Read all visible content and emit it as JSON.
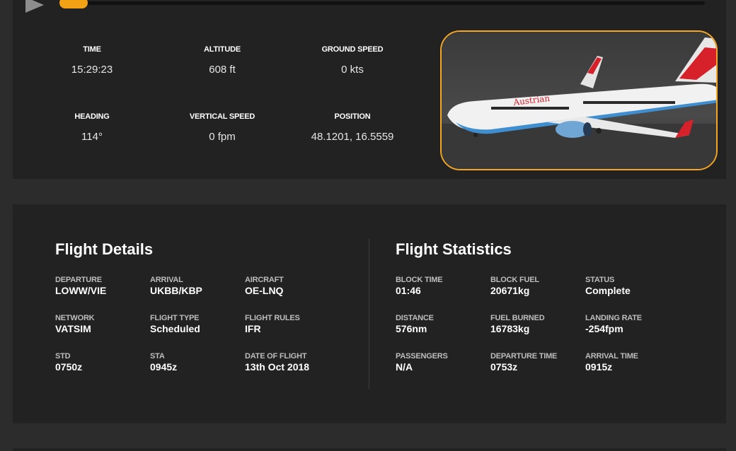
{
  "player": {
    "play_icon": "play-icon",
    "progress_fraction": 0.0,
    "accent": "#f3a215"
  },
  "live": [
    {
      "label": "TIME",
      "value": "15:29:23"
    },
    {
      "label": "ALTITUDE",
      "value": "608 ft"
    },
    {
      "label": "GROUND SPEED",
      "value": "0 kts"
    },
    {
      "label": "HEADING",
      "value": "114°"
    },
    {
      "label": "VERTICAL SPEED",
      "value": "0 fpm"
    },
    {
      "label": "POSITION",
      "value": "48.1201, 16.5559"
    }
  ],
  "photo": {
    "livery_text": "Austrian",
    "border_color": "#f5a623"
  },
  "flight_details": {
    "title": "Flight Details",
    "fields": [
      {
        "label": "DEPARTURE",
        "value": "LOWW/VIE"
      },
      {
        "label": "ARRIVAL",
        "value": "UKBB/KBP"
      },
      {
        "label": "AIRCRAFT",
        "value": "OE-LNQ"
      },
      {
        "label": "NETWORK",
        "value": "VATSIM"
      },
      {
        "label": "FLIGHT TYPE",
        "value": "Scheduled"
      },
      {
        "label": "FLIGHT RULES",
        "value": "IFR"
      },
      {
        "label": "STD",
        "value": "0750z"
      },
      {
        "label": "STA",
        "value": "0945z"
      },
      {
        "label": "DATE OF FLIGHT",
        "value": "13th Oct 2018"
      }
    ]
  },
  "flight_statistics": {
    "title": "Flight Statistics",
    "fields": [
      {
        "label": "BLOCK TIME",
        "value": "01:46"
      },
      {
        "label": "BLOCK FUEL",
        "value": "20671kg"
      },
      {
        "label": "STATUS",
        "value": "Complete"
      },
      {
        "label": "DISTANCE",
        "value": "576nm"
      },
      {
        "label": "FUEL BURNED",
        "value": "16783kg"
      },
      {
        "label": "LANDING RATE",
        "value": "-254fpm"
      },
      {
        "label": "PASSENGERS",
        "value": "N/A"
      },
      {
        "label": "DEPARTURE TIME",
        "value": "0753z"
      },
      {
        "label": "ARRIVAL TIME",
        "value": "0915z"
      }
    ]
  }
}
